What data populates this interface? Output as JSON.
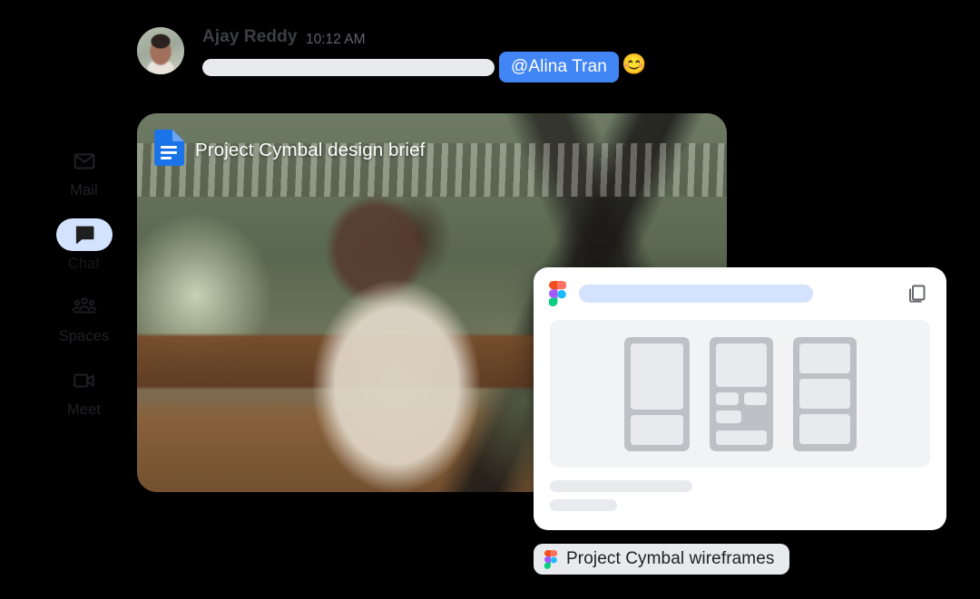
{
  "app": {
    "background_color": "#000000",
    "accent_blue": "#4285F4",
    "chip_blue": "#D3E3FD",
    "placeholder_gray": "#E8EAED"
  },
  "sidebar": {
    "items": [
      {
        "label": "Mail",
        "icon": "mail-icon",
        "active": false
      },
      {
        "label": "Chat",
        "icon": "chat-icon",
        "active": true
      },
      {
        "label": "Spaces",
        "icon": "spaces-icon",
        "active": false
      },
      {
        "label": "Meet",
        "icon": "meet-icon",
        "active": false
      }
    ]
  },
  "message": {
    "sender": "Ajay Reddy",
    "timestamp": "10:12 AM",
    "body_placeholder": "",
    "mention": "@Alina Tran",
    "emoji": "☺",
    "avatar_alt": "Ajay Reddy avatar"
  },
  "docs_card": {
    "icon": "google-docs-icon",
    "title": "Project Cymbal design brief",
    "image_alt": "Woman with headphones working at laptop in a bright room"
  },
  "figma_card": {
    "logo": "figma-logo-icon",
    "url_placeholder": "",
    "copy_icon": "copy-icon",
    "canvas_alt": "Wireframe frames preview",
    "caption_line_1": "",
    "caption_line_2": ""
  },
  "file_chip": {
    "logo": "figma-logo-icon",
    "label": "Project Cymbal wireframes"
  }
}
